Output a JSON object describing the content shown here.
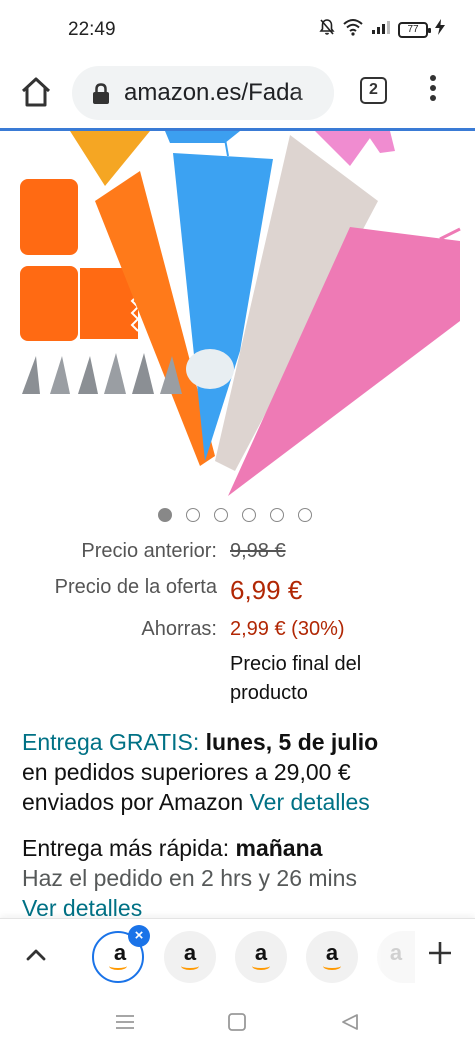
{
  "status_bar": {
    "time": "22:49",
    "battery": "77"
  },
  "browser": {
    "url": "amazon.es/Fada",
    "tab_count": "2"
  },
  "product": {
    "carousel": {
      "total": 6,
      "active_index": 0
    },
    "pricing": {
      "previous_label": "Precio anterior:",
      "previous_value": "9,98 €",
      "deal_label": "Precio de la oferta",
      "deal_value": "6,99 €",
      "savings_label": "Ahorras:",
      "savings_value": "2,99 € (30%)",
      "final_note_line1": "Precio final del",
      "final_note_line2": "producto"
    },
    "delivery": {
      "free_label": "Entrega GRATIS:",
      "date": "lunes, 5 de julio",
      "line2": "en pedidos superiores a 29,00 €",
      "line3": "enviados por Amazon",
      "details_link": "Ver detalles"
    },
    "fast_delivery": {
      "label": "Entrega más rápida:",
      "day": "mañana",
      "countdown": "Haz el pedido en 2 hrs y 26 mins",
      "details_link": "Ver detalles"
    }
  },
  "tab_strip": {
    "tab_letter": "a",
    "close_symbol": "×",
    "accent": "#1a73e8"
  },
  "colors": {
    "price_red": "#b12704",
    "link_teal": "#007185",
    "amazon_orange": "#ff9900"
  }
}
